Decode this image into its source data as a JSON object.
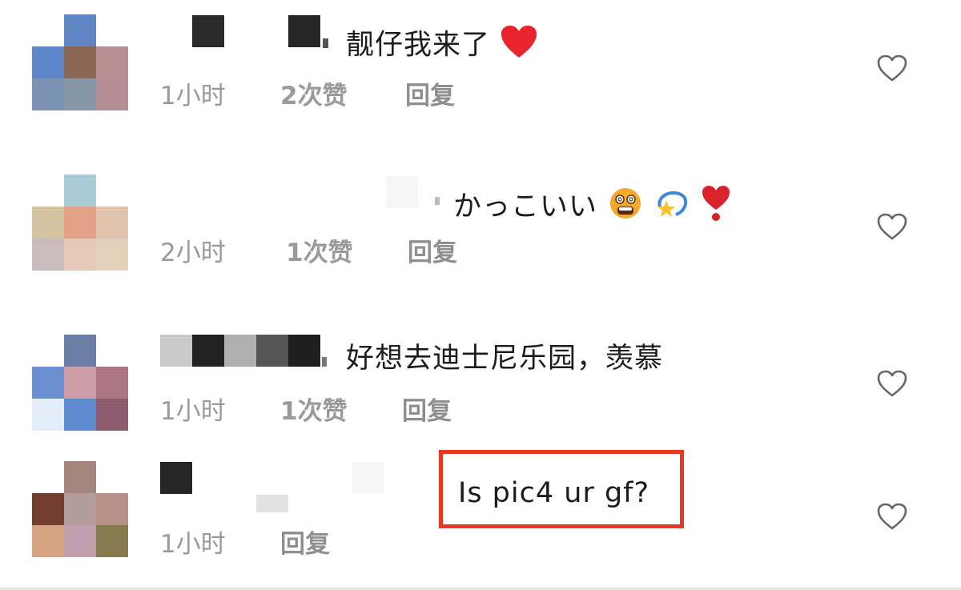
{
  "comments": [
    {
      "text": "靓仔我来了",
      "emoji": [
        "heart-icon"
      ],
      "time": "1小时",
      "likes": "2次赞",
      "reply": "回复"
    },
    {
      "text": "かっこいい",
      "emoji": [
        "dizzy-face-icon",
        "dizzy-star-icon",
        "heart-exclamation-icon"
      ],
      "time": "2小时",
      "likes": "1次赞",
      "reply": "回复"
    },
    {
      "text": "好想去迪士尼乐园，羡慕",
      "emoji": [],
      "time": "1小时",
      "likes": "1次赞",
      "reply": "回复"
    },
    {
      "text": "Is pic4 ur gf?",
      "emoji": [],
      "time": "1小时",
      "likes": "",
      "reply": "回复"
    }
  ],
  "colors": {
    "highlight_border": "#e8361f",
    "meta_text": "#9a9a9a",
    "heart_emoji": "#e8242c"
  }
}
